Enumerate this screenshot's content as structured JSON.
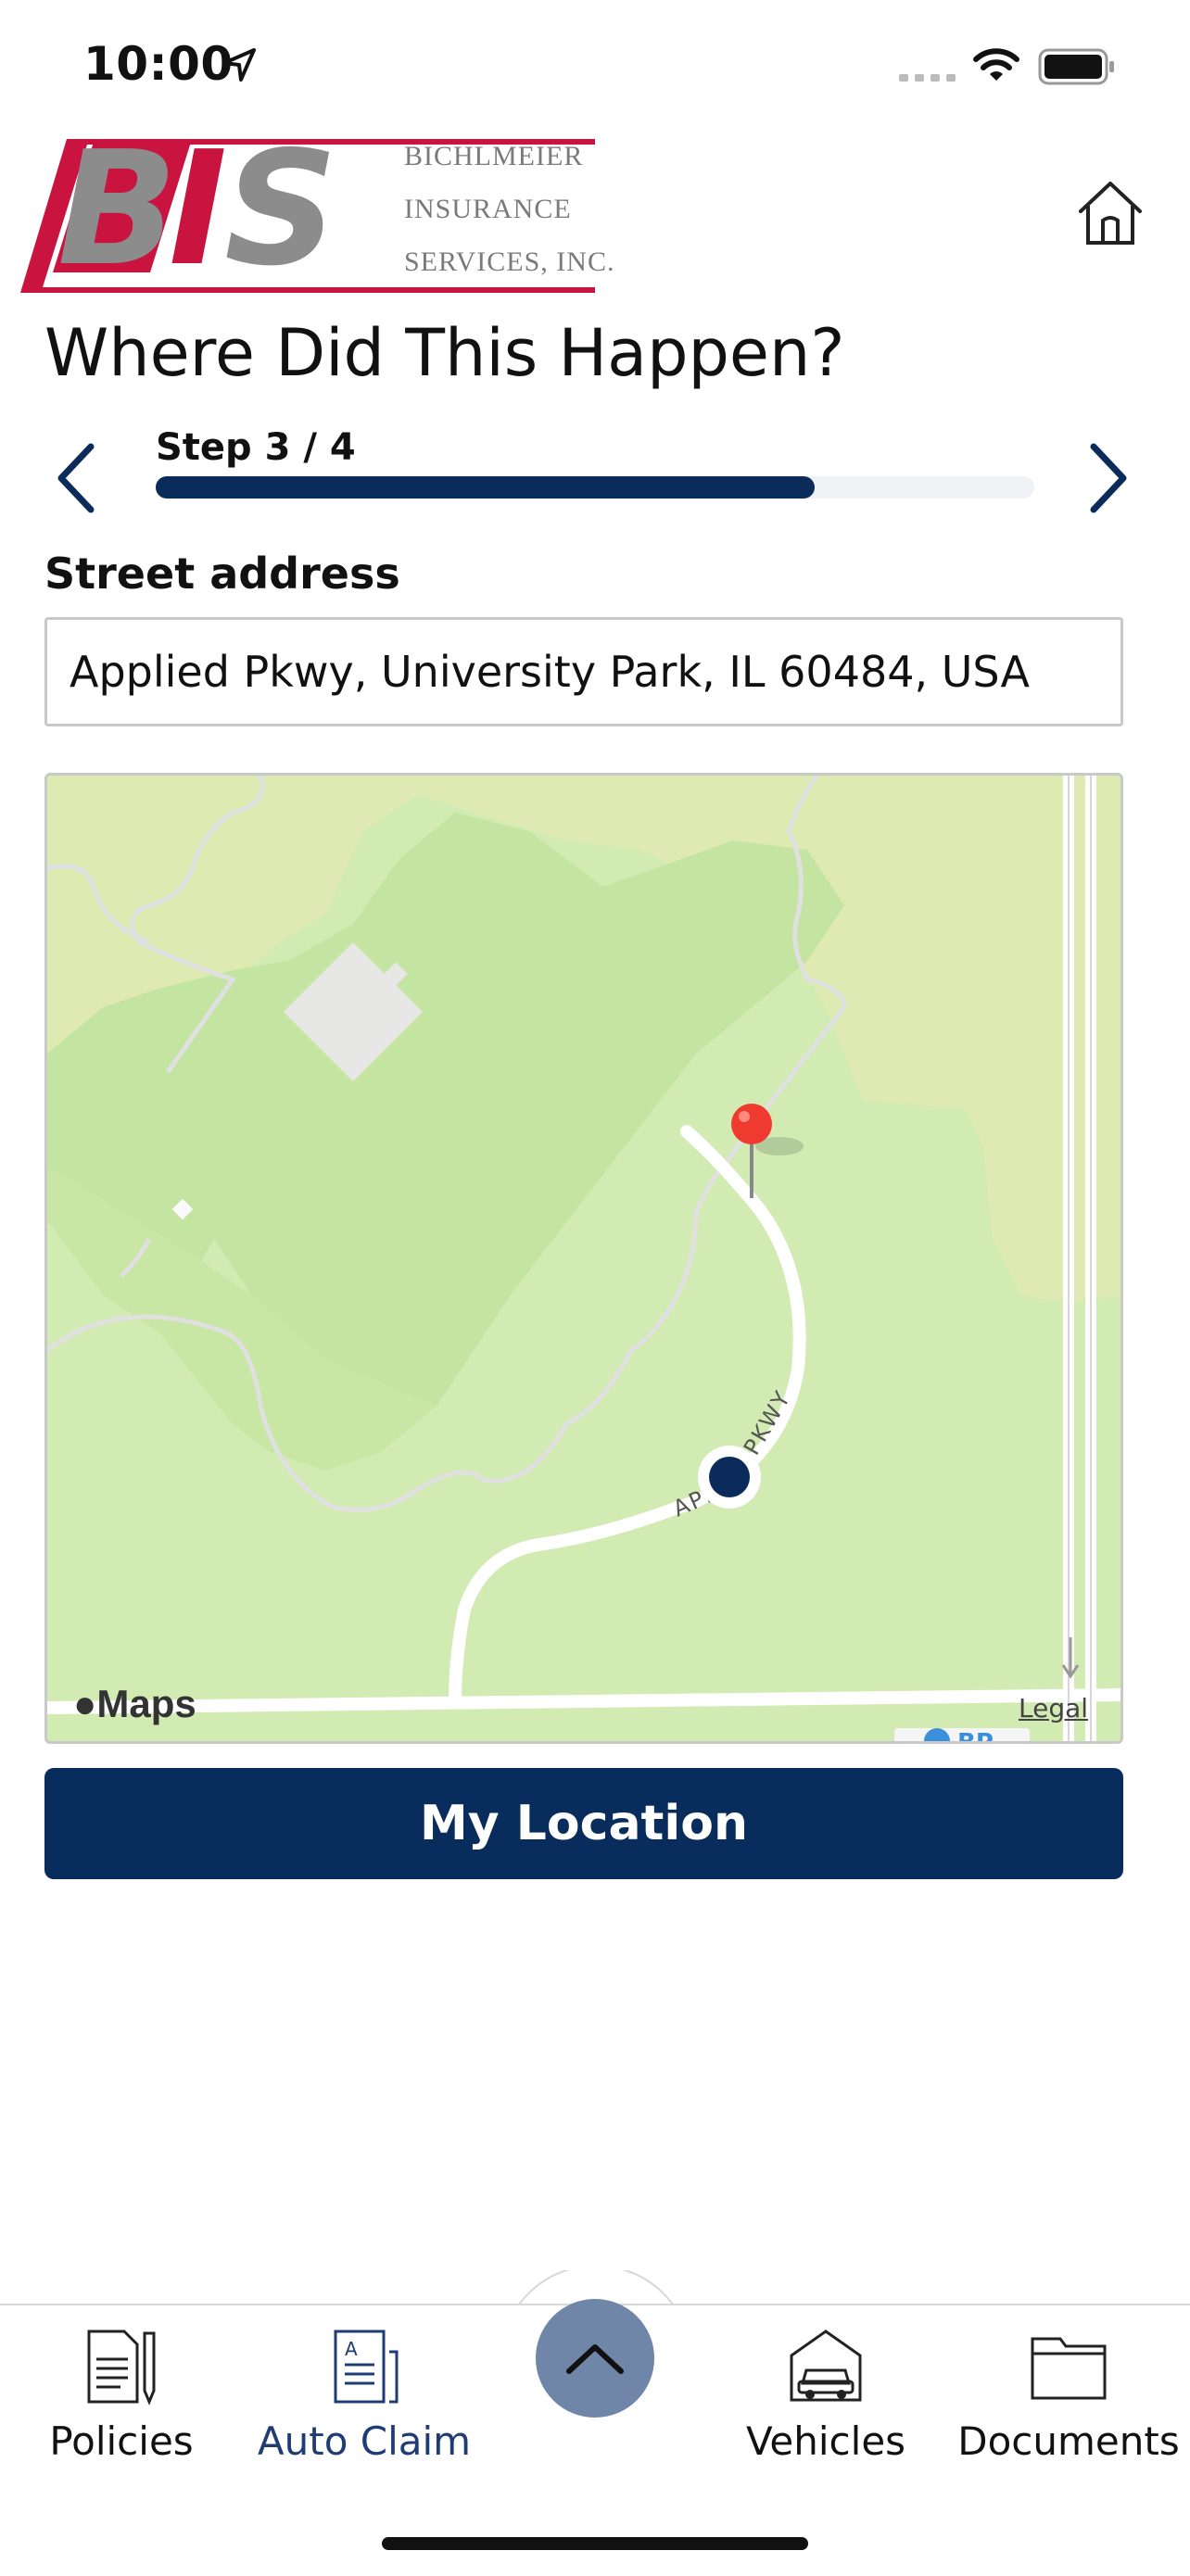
{
  "status_bar": {
    "time": "10:00"
  },
  "brand": {
    "logo_letters": "BIS",
    "name_lines": [
      "BICHLMEIER",
      "INSURANCE",
      "SERVICES, INC."
    ],
    "colors": {
      "red": "#c8143f",
      "gray": "#8c8c8c"
    }
  },
  "page": {
    "title": "Where Did This Happen?",
    "step_label": "Step 3 / 4",
    "progress": 0.75
  },
  "form": {
    "street_label": "Street address",
    "street_value": "Applied Pkwy, University Park, IL 60484, USA"
  },
  "map": {
    "road_label": "APPLIED PKWY",
    "brand": "Maps",
    "legal": "Legal",
    "poi_label": "BP"
  },
  "actions": {
    "my_location": "My Location"
  },
  "tabs": [
    {
      "label": "Policies",
      "icon": "document-pen-icon"
    },
    {
      "label": "Auto Claim",
      "icon": "claim-form-icon",
      "active": true
    },
    {
      "label": "Vehicles",
      "icon": "car-garage-icon"
    },
    {
      "label": "Documents",
      "icon": "folder-icon"
    }
  ],
  "accent_color": "#082c5b"
}
